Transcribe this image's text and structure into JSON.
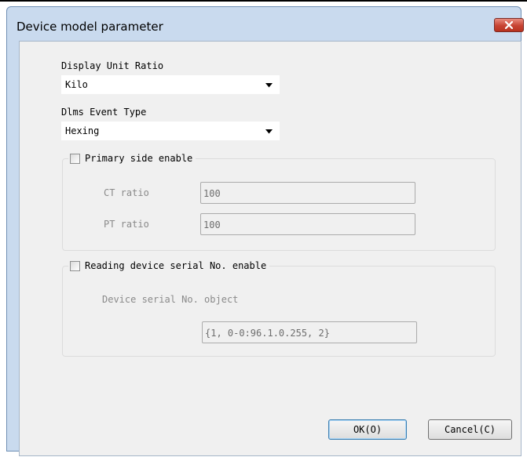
{
  "dialog": {
    "title": "Device model parameter",
    "close_icon": "close-x-icon",
    "accent_color": "#c74433"
  },
  "display_unit_ratio": {
    "label": "Display Unit Ratio",
    "value": "Kilo"
  },
  "dlms_event_type": {
    "label": "Dlms Event Type",
    "value": "Hexing"
  },
  "primary_side": {
    "checkbox_label": "Primary side enable",
    "checked": false,
    "ct_label": "CT ratio",
    "ct_value": "100",
    "pt_label": "PT ratio",
    "pt_value": "100"
  },
  "serial": {
    "checkbox_label": "Reading device serial No. enable",
    "checked": false,
    "object_label": "Device serial No. object",
    "object_value": "{1, 0-0:96.1.0.255, 2}"
  },
  "buttons": {
    "ok": "OK(O)",
    "cancel": "Cancel(C)"
  }
}
